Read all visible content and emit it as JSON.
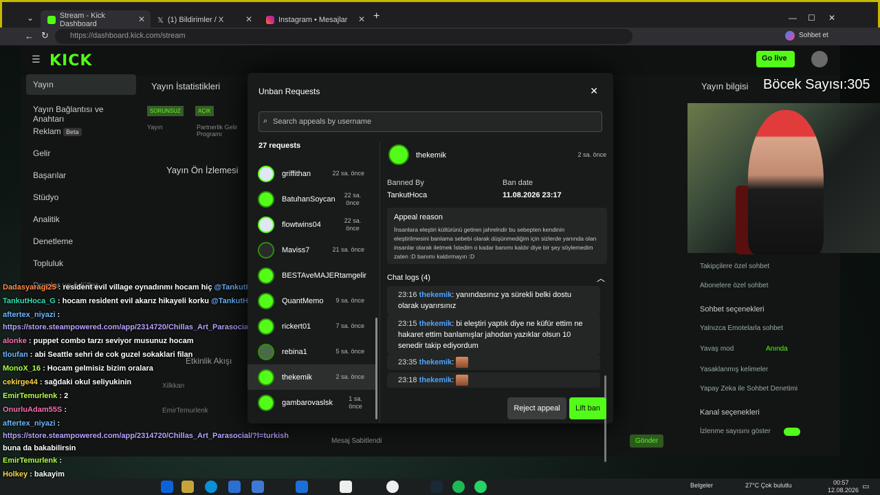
{
  "browser": {
    "tabs": [
      {
        "label": "Stream - Kick Dashboard",
        "active": true
      },
      {
        "label": "(1) Bildirimler / X",
        "active": false
      },
      {
        "label": "Instagram • Mesajlar",
        "active": false
      }
    ],
    "url": "https://dashboard.kick.com/stream",
    "profile_label": "Sohbet et"
  },
  "kick": {
    "logo": "KICK",
    "go_live": "Go live",
    "sidebar": [
      {
        "label": "Yayın"
      },
      {
        "label": "Yayın Bağlantısı ve Anahtarı"
      },
      {
        "label": "Reklam",
        "badge": "Beta"
      },
      {
        "label": "Gelir"
      },
      {
        "label": "Başarılar"
      },
      {
        "label": "Stüdyo"
      },
      {
        "label": "Analitik"
      },
      {
        "label": "Denetleme"
      },
      {
        "label": "Topluluk"
      },
      {
        "label": "Droplar ve ödüller"
      }
    ],
    "stats_title": "Yayın İstatistikleri",
    "stats_badges": [
      "SORUNSUZ",
      "AÇIK"
    ],
    "stats_cols": [
      "Yayın",
      "Partnerlik Gelir Programı"
    ],
    "preview_title": "Yayın Ön İzlemesi",
    "activity_title": "Etkinlik Akışı",
    "activity_users": [
      "Xilkkan",
      "EmirTemurlenk"
    ],
    "info_title": "Yayın bilgisi",
    "right_options": [
      "Takipçilere özel sohbet",
      "Abonelere özel sohbet",
      "Sohbet seçenekleri",
      "Yalnızca Emotelarla sohbet",
      "Yavaş mod",
      "Yasaklanmış kelimeler",
      "Yapay Zeka ile Sohbet Denetimi",
      "Kanal seçenekleri",
      "İzlenme sayısını göster"
    ],
    "slow_mode_value": "Anında",
    "pinned": "Mesaj Sabitlendi",
    "send": "Gönder"
  },
  "modal": {
    "title": "Unban Requests",
    "search_placeholder": "Search appeals by username",
    "count_label": "27 requests",
    "requests": [
      {
        "user": "griffithan",
        "time": "22 sa. önce"
      },
      {
        "user": "BatuhanSoycan",
        "time": "22 sa. önce"
      },
      {
        "user": "flowtwins04",
        "time": "22 sa. önce"
      },
      {
        "user": "Maviss7",
        "time": "21 sa. önce"
      },
      {
        "user": "BESTAveMAJERtamgelir",
        "time": ""
      },
      {
        "user": "QuantMemo",
        "time": "9 sa. önce"
      },
      {
        "user": "rickert01",
        "time": "7 sa. önce"
      },
      {
        "user": "rebina1",
        "time": "5 sa. önce"
      },
      {
        "user": "thekemik",
        "time": "2 sa. önce",
        "selected": true
      },
      {
        "user": "gambarovaslsk",
        "time": "1 sa. önce"
      }
    ],
    "detail": {
      "user": "thekemik",
      "time": "2 sa. önce",
      "banned_by_label": "Banned By",
      "banned_by": "TankutHoca",
      "ban_date_label": "Ban date",
      "ban_date": "11.08.2026 23:17",
      "appeal_reason_label": "Appeal reason",
      "appeal_reason": "İnsanlara eleştiri kültürünü getiren jahrelndir bu sebepten kendinin eleştirilmesini banlama sebebi olarak düşünmediğim için sizlerde yanında olan insanlar olarak iletmek İstedim o kadar banımı kaldır diye bir şey söylemedim zaten :D banımı kaldırmayın :D",
      "chat_logs_label": "Chat logs (4)",
      "logs": [
        {
          "time": "23:16",
          "user": "thekemik",
          "text": "yanındasınız ya sürekli belki dostu olarak uyarırsınız"
        },
        {
          "time": "23:15",
          "user": "thekemik",
          "text": "bi eleştiri yaptık diye ne küfür ettim ne hakaret ettim banlamışlar jahodan yazıklar olsun 10 senedir takip ediyordum"
        },
        {
          "time": "23:35",
          "user": "thekemik",
          "text": ""
        },
        {
          "time": "23:18",
          "user": "thekemik",
          "text": ""
        }
      ]
    },
    "reject_label": "Reject appeal",
    "lift_label": "Lift ban"
  },
  "overlay": {
    "counter": "Böcek Sayısı:305"
  },
  "chat_overlay": [
    {
      "user": "Dadasyaragi25",
      "text": "resident evil village oynadınmı hocam hiç",
      "mention": "@TankutHoca",
      "cls": "u1"
    },
    {
      "user": "TankutHoca_G",
      "text": "hocam resident evil akarız hikayeli korku",
      "mention": "@TankutHoca",
      "cls": "u2"
    },
    {
      "user": "aftertex_niyazi",
      "text": "",
      "mention": "",
      "cls": "u3"
    },
    {
      "user": "",
      "text": "https://store.steampowered.com/app/2314720/Chillas_Art_Parasocial/?l=turkish",
      "mention": "",
      "cls": "link"
    },
    {
      "user": "alonke",
      "text": "puppet combo tarzı seviyor musunuz hocam",
      "mention": "",
      "cls": "u7"
    },
    {
      "user": "tloufan",
      "text": "abi Seattle sehri de cok guzel sokaklari filan",
      "mention": "",
      "cls": "u3"
    },
    {
      "user": "MonoX_16",
      "text": "Hocam gelmisiz bizim oralara",
      "mention": "",
      "cls": "u6"
    },
    {
      "user": "cekirge44",
      "text": "sağdaki okul seliyukinin",
      "mention": "",
      "cls": "u4"
    },
    {
      "user": "EmirTemurlenk",
      "text": "2",
      "mention": "",
      "cls": "u6"
    },
    {
      "user": "OnurluAdam55S",
      "text": "",
      "mention": "",
      "cls": "u7"
    },
    {
      "user": "aftertex_niyazi",
      "text": "",
      "mention": "",
      "cls": "u3"
    },
    {
      "user": "",
      "text": "https://store.steampowered.com/app/2314720/Chillas_Art_Parasocial/?l=turkish",
      "mention": "",
      "cls": "link"
    },
    {
      "user": "",
      "text": "buna da bakabilirsin",
      "mention": "",
      "cls": "u0"
    },
    {
      "user": "EmirTemurlenk",
      "text": "",
      "mention": "",
      "cls": "u6"
    },
    {
      "user": "Holkey",
      "text": "bakayim",
      "mention": "",
      "cls": "u4"
    },
    {
      "user": "OnurluAdam55S",
      "text": "",
      "mention": "",
      "cls": "u7"
    }
  ],
  "taskbar": {
    "folder_label": "Belgeler",
    "weather": "27°C  Çok bulutlu",
    "clock_time": "00:57",
    "clock_date": "12.08.2026"
  }
}
